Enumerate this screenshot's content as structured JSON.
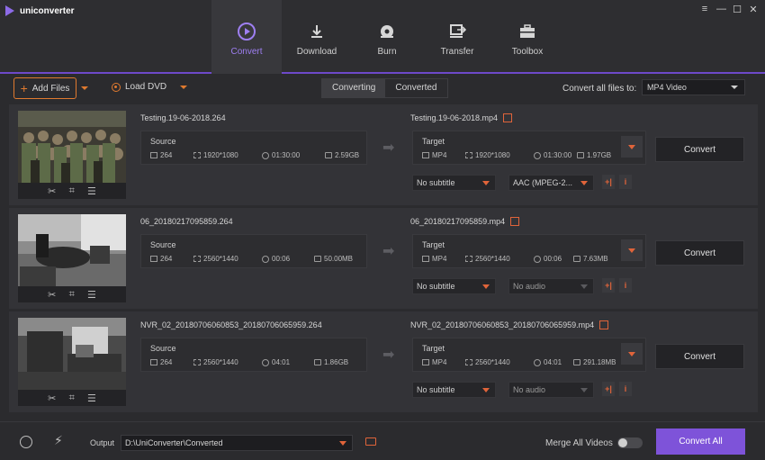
{
  "app": {
    "name": "uniconverter"
  },
  "window_controls": [
    "≡",
    "—",
    "☐",
    "✕"
  ],
  "nav": {
    "tabs": [
      {
        "label": "Convert",
        "icon": "convert-icon",
        "active": true
      },
      {
        "label": "Download",
        "icon": "download-icon",
        "active": false
      },
      {
        "label": "Burn",
        "icon": "burn-icon",
        "active": false
      },
      {
        "label": "Transfer",
        "icon": "transfer-icon",
        "active": false
      },
      {
        "label": "Toolbox",
        "icon": "toolbox-icon",
        "active": false
      }
    ]
  },
  "toolbar": {
    "add_files": "Add Files",
    "load_dvd": "Load DVD",
    "segments": {
      "converting": "Converting",
      "converted": "Converted"
    },
    "convert_all_label": "Convert all files to:",
    "format": "MP4 Video"
  },
  "files": [
    {
      "source_name": "Testing.19-06-2018.264",
      "source": {
        "title": "Source",
        "format": "264",
        "resolution": "1920*1080",
        "duration": "01:30:00",
        "size": "2.59GB"
      },
      "target_name": "Testing.19-06-2018.mp4",
      "target": {
        "title": "Target",
        "format": "MP4",
        "resolution": "1920*1080",
        "duration": "01:30:00",
        "size": "1.97GB"
      },
      "subtitle": "No subtitle",
      "audio": "AAC (MPEG-2...",
      "convert": "Convert"
    },
    {
      "source_name": "06_20180217095859.264",
      "source": {
        "title": "Source",
        "format": "264",
        "resolution": "2560*1440",
        "duration": "00:06",
        "size": "50.00MB"
      },
      "target_name": "06_20180217095859.mp4",
      "target": {
        "title": "Target",
        "format": "MP4",
        "resolution": "2560*1440",
        "duration": "00:06",
        "size": "7.63MB"
      },
      "subtitle": "No subtitle",
      "audio": "No audio",
      "convert": "Convert"
    },
    {
      "source_name": "NVR_02_20180706060853_20180706065959.264",
      "source": {
        "title": "Source",
        "format": "264",
        "resolution": "2560*1440",
        "duration": "04:01",
        "size": "1.86GB"
      },
      "target_name": "NVR_02_20180706060853_20180706065959.mp4",
      "target": {
        "title": "Target",
        "format": "MP4",
        "resolution": "2560*1440",
        "duration": "04:01",
        "size": "291.18MB"
      },
      "subtitle": "No subtitle",
      "audio": "No audio",
      "convert": "Convert"
    }
  ],
  "thumb_tools": [
    "✂",
    "⌗",
    "☰"
  ],
  "bottom": {
    "output_label": "Output",
    "output_path": "D:\\UniConverter\\Converted",
    "merge_label": "Merge All Videos",
    "convert_all": "Convert All"
  },
  "colors": {
    "accent": "#7e53d9",
    "highlight": "#e0643a",
    "add_border": "#e07a2f"
  }
}
